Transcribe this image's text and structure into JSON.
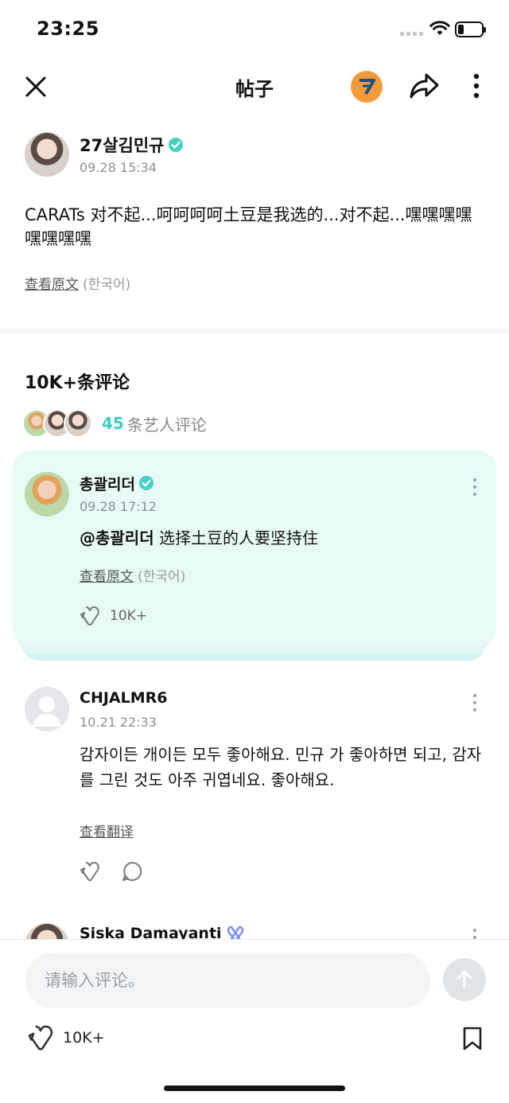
{
  "status_bar": {
    "time": "23:25",
    "battery_level": 0.25
  },
  "nav": {
    "title": "帖子"
  },
  "post": {
    "author": "27살김민규",
    "timestamp": "09.28 15:34",
    "body": "CARATs 对不起...呵呵呵呵土豆是我选的...对不起...嘿嘿嘿嘿嘿嘿嘿嘿",
    "translate_link": "查看原文",
    "language": "(한국어)"
  },
  "comments_header": {
    "title": "10K+条评论",
    "artist_count": "45",
    "artist_label": "条艺人评论"
  },
  "comments": [
    {
      "author": "총괄리더",
      "timestamp": "09.28 17:12",
      "mention": "@총괄리더",
      "body": " 选择土豆的人要坚持住",
      "translate_link": "查看原文",
      "language": "(한국어)",
      "likes": "10K+"
    },
    {
      "author": "CHJALMR6",
      "timestamp": "10.21 22:33",
      "body": "감자이든 개이든 모두 좋아해요. 민규 가 좋아하면 되고, 감자를 그린 것도 아주 귀엽네요. 좋아해요.",
      "translate_link": "查看翻译"
    },
    {
      "author": "Siska Damayanti"
    }
  ],
  "bottom_bar": {
    "placeholder": "请输入评论。",
    "likes": "10K+"
  },
  "colors": {
    "accent": "#3bcdc0",
    "card_bg": "#e8faf6",
    "brand_badge": "#f29b3a"
  }
}
